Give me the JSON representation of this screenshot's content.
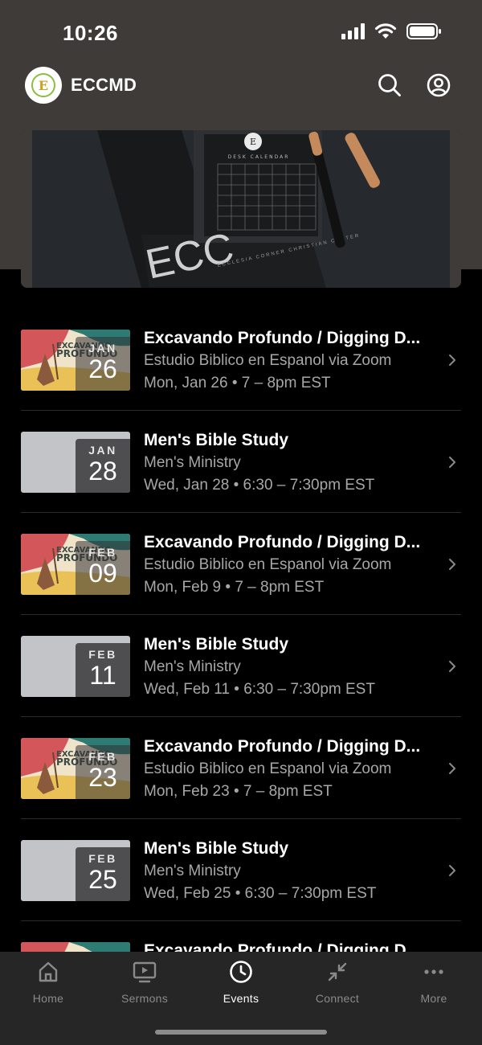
{
  "status_bar": {
    "time": "10:26"
  },
  "header": {
    "app_name": "ECCMD",
    "logo_letter": "E",
    "search_icon": "search-icon",
    "profile_icon": "profile-icon"
  },
  "hero": {
    "calendar_title": "DESK CALENDAR",
    "calendar_days": [
      "S",
      "M",
      "T",
      "W",
      "T",
      "F",
      "S"
    ],
    "big_text": "ECC",
    "card_text": "ECCLESIA CORNER CHRISTIAN CENTER"
  },
  "events": [
    {
      "title": "Excavando Profundo / Digging D...",
      "subtitle": "Estudio Biblico en Espanol via Zoom",
      "when": "Mon, Jan 26 • 7 – 8pm EST",
      "month": "JAN",
      "day": "26",
      "thumb": "art"
    },
    {
      "title": "Men's Bible Study",
      "subtitle": "Men's Ministry",
      "when": "Wed, Jan 28 • 6:30 – 7:30pm EST",
      "month": "JAN",
      "day": "28",
      "thumb": "plain"
    },
    {
      "title": "Excavando Profundo / Digging D...",
      "subtitle": "Estudio Biblico en Espanol via Zoom",
      "when": "Mon, Feb 9 • 7 – 8pm EST",
      "month": "FEB",
      "day": "09",
      "thumb": "art"
    },
    {
      "title": "Men's Bible Study",
      "subtitle": "Men's Ministry",
      "when": "Wed, Feb 11 • 6:30 – 7:30pm EST",
      "month": "FEB",
      "day": "11",
      "thumb": "plain"
    },
    {
      "title": "Excavando Profundo / Digging D...",
      "subtitle": "Estudio Biblico en Espanol via Zoom",
      "when": "Mon, Feb 23 • 7 – 8pm EST",
      "month": "FEB",
      "day": "23",
      "thumb": "art"
    },
    {
      "title": "Men's Bible Study",
      "subtitle": "Men's Ministry",
      "when": "Wed, Feb 25 • 6:30 – 7:30pm EST",
      "month": "FEB",
      "day": "25",
      "thumb": "plain"
    },
    {
      "title": "Excavando Profundo / Digging D...",
      "subtitle": "",
      "when": "",
      "month": "",
      "day": "",
      "thumb": "art"
    }
  ],
  "art_text": {
    "line1": "EXCAVANDO",
    "line2": "PROFUNDO"
  },
  "tabs": [
    {
      "label": "Home",
      "icon": "home-icon",
      "active": false
    },
    {
      "label": "Sermons",
      "icon": "tv-icon",
      "active": false
    },
    {
      "label": "Events",
      "icon": "clock-icon",
      "active": true
    },
    {
      "label": "Connect",
      "icon": "collapse-arrows-icon",
      "active": false
    },
    {
      "label": "More",
      "icon": "more-dots-icon",
      "active": false
    }
  ],
  "colors": {
    "top_background": "#3e3b39",
    "tab_bar": "#262626",
    "active_tab": "#ffffff",
    "inactive_tab": "#8a8a8a"
  }
}
